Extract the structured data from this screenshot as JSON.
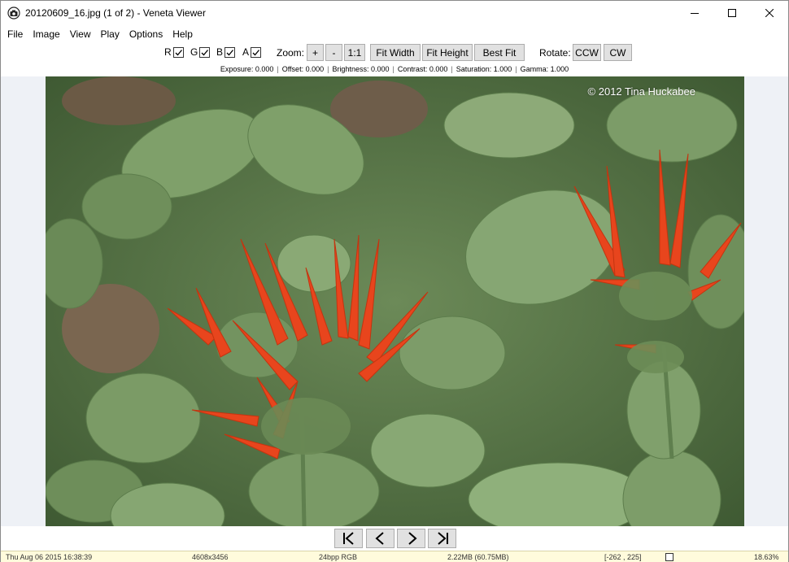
{
  "window": {
    "title": "20120609_16.jpg (1 of 2) - Veneta Viewer",
    "icon": "camera-app-icon"
  },
  "menu": {
    "items": [
      "File",
      "Image",
      "View",
      "Play",
      "Options",
      "Help"
    ]
  },
  "toolbar": {
    "channels": [
      {
        "label": "R",
        "checked": true
      },
      {
        "label": "G",
        "checked": true
      },
      {
        "label": "B",
        "checked": true
      },
      {
        "label": "A",
        "checked": true
      }
    ],
    "zoom_label": "Zoom:",
    "zoom_in": "+",
    "zoom_out": "-",
    "zoom_actual": "1:1",
    "fit_width": "Fit Width",
    "fit_height": "Fit Height",
    "best_fit": "Best Fit",
    "rotate_label": "Rotate:",
    "rotate_ccw": "CCW",
    "rotate_cw": "CW"
  },
  "adjustments": {
    "exposure": "Exposure: 0.000",
    "offset": "Offset: 0.000",
    "brightness": "Brightness: 0.000",
    "contrast": "Contrast: 0.000",
    "saturation": "Saturation: 1.000",
    "gamma": "Gamma: 1.000"
  },
  "image": {
    "watermark": "© 2012 Tina Huckabee",
    "background_color": "#eef1f6"
  },
  "navigation": {
    "first": "first-image-icon",
    "previous": "previous-image-icon",
    "next": "next-image-icon",
    "last": "last-image-icon"
  },
  "status": {
    "datetime": "Thu Aug 06 2015 16:38:39",
    "dimensions": "4608x3456",
    "format": "24bpp RGB",
    "filesize": "2.22MB (60.75MB)",
    "cursor": "[-262 , 225]",
    "zoom": "18.63%",
    "background_color": "#fffbdc"
  }
}
